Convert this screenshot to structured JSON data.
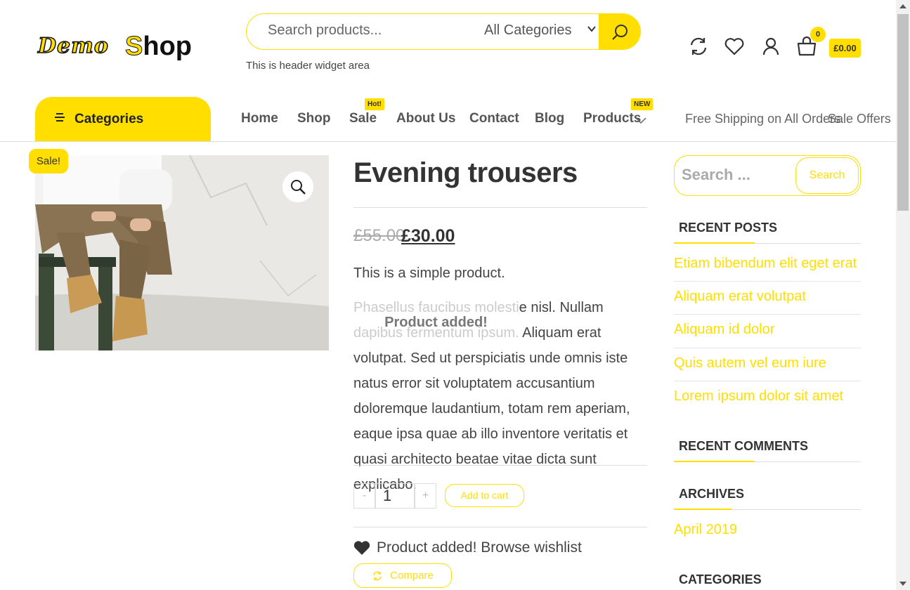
{
  "header": {
    "logo_part1": "Demo",
    "logo_part2_first": "S",
    "logo_part2_rest": "hop",
    "search_placeholder": "Search products...",
    "category_select": "All Categories",
    "widget_text": "This is header widget area",
    "cart_count": "0",
    "cart_total": "£0.00"
  },
  "nav": {
    "categories_label": "Categories",
    "items": [
      {
        "label": "Home"
      },
      {
        "label": "Shop"
      },
      {
        "label": "Sale",
        "tag": "Hot!"
      },
      {
        "label": "About Us"
      },
      {
        "label": "Contact"
      },
      {
        "label": "Blog"
      },
      {
        "label": "Products",
        "tag": "NEW"
      }
    ],
    "right_links": [
      "Free Shipping on All Orders",
      "Sale Offers"
    ]
  },
  "product": {
    "sale_badge": "Sale!",
    "title": "Evening trousers",
    "old_price": "£55.00",
    "new_price": "£30.00",
    "short_description": "This is a simple product.",
    "description": "Phasellus faucibus molestie nisl. Nullam dapibus fermentum ipsum. Aliquam erat volutpat. Sed ut perspiciatis unde omnis iste natus error sit voluptatem accusantium doloremque laudantium, totam rem aperiam, eaque ipsa quae ab illo inventore veritatis et quasi architecto beatae vitae dicta sunt explicabo.",
    "toast": "Product added!",
    "qty_minus": "-",
    "quantity": "1",
    "qty_plus": "+",
    "add_to_cart": "Add to cart",
    "wishlist_text": "Product added! Browse wishlist",
    "compare": "Compare"
  },
  "sidebar": {
    "search_placeholder": "Search ...",
    "search_button": "Search",
    "recent_posts_title": "RECENT POSTS",
    "recent_posts": [
      "Etiam bibendum elit eget erat",
      "Aliquam erat volutpat",
      "Aliquam id dolor",
      "Quis autem vel eum iure",
      "Lorem ipsum dolor sit amet"
    ],
    "recent_comments_title": "RECENT COMMENTS",
    "archives_title": "ARCHIVES",
    "archives": [
      "April 2019"
    ],
    "categories_title": "CATEGORIES"
  },
  "colors": {
    "accent": "#ffde00",
    "text": "#333333"
  },
  "icons": [
    "search-icon",
    "refresh-icon",
    "heart-icon",
    "user-icon",
    "cart-icon",
    "zoom-icon",
    "chevron-down-icon",
    "menu-icon"
  ]
}
